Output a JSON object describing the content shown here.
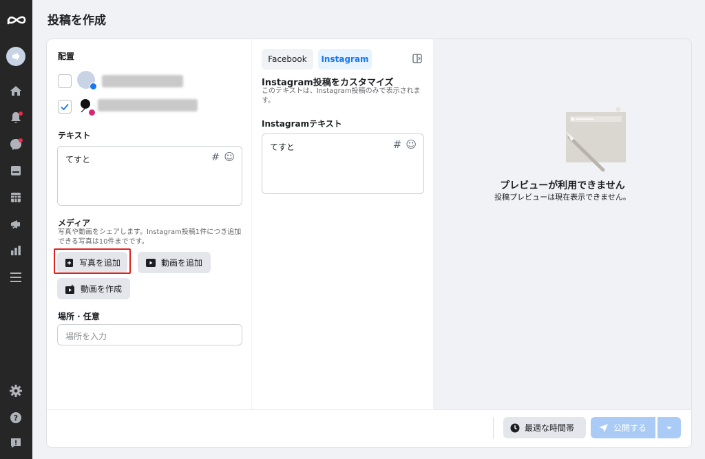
{
  "page": {
    "title": "投稿を作成"
  },
  "rail": {
    "icons": [
      "meta-logo-icon",
      "account-avatar-icon",
      "home-icon",
      "notifications-icon",
      "messages-icon",
      "pages-icon",
      "calendar-icon",
      "megaphone-icon",
      "insights-icon",
      "menu-icon",
      "settings-icon",
      "help-icon",
      "report-icon"
    ]
  },
  "placement": {
    "heading": "配置",
    "accounts": [
      {
        "network": "facebook",
        "checked": false
      },
      {
        "network": "instagram",
        "checked": true
      }
    ]
  },
  "text_section": {
    "heading": "テキスト",
    "value": "てすと"
  },
  "media": {
    "heading": "メディア",
    "help": "写真や動画をシェアします。Instagram投稿1件につき追加できる写真は10件までです。",
    "add_photo": "写真を追加",
    "add_video": "動画を追加",
    "create_video": "動画を作成"
  },
  "location": {
    "heading": "場所 · 任意",
    "placeholder": "場所を入力"
  },
  "customize": {
    "tabs": [
      "Facebook",
      "Instagram"
    ],
    "active_tab": "Instagram",
    "title": "Instagram投稿をカスタマイズ",
    "description": "このテキストは、Instagram投稿のみで表示されます。",
    "field_label": "Instagramテキスト",
    "value": "てすと"
  },
  "preview": {
    "title": "プレビューが利用できません",
    "message": "投稿プレビューは現在表示できません。"
  },
  "footer": {
    "best_time": "最適な時間帯",
    "publish": "公開する"
  },
  "colors": {
    "accent": "#1877f2",
    "publish_disabled": "#aacbf5",
    "highlight": "#e41e1e"
  }
}
